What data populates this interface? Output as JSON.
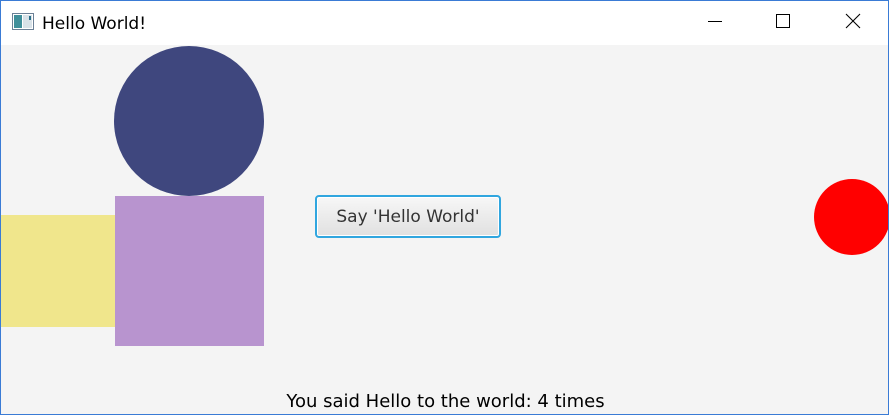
{
  "window": {
    "title": "Hello World!",
    "controls": {
      "minimize": "minimize-icon",
      "maximize": "maximize-icon",
      "close": "close-icon"
    }
  },
  "content": {
    "background": "#f4f4f4",
    "button_label": "Say 'Hello World'",
    "counter_text": "You said Hello to the world: 4 times",
    "shapes": {
      "navy_circle_color": "#3f477e",
      "purple_square_color": "#b894cf",
      "yellow_rect_color": "#f0e68c",
      "red_circle_color": "#ff0000"
    }
  },
  "colors": {
    "button_focus_border": "#30a6df",
    "window_border": "#3a7bd5"
  }
}
